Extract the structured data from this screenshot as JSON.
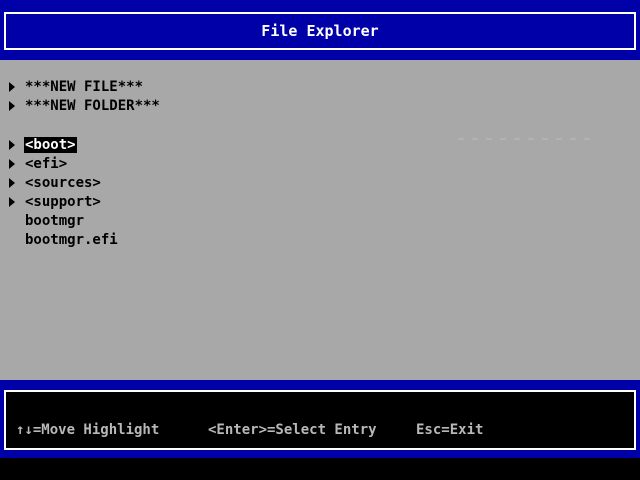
{
  "title": "File Explorer",
  "colors": {
    "title_bg": "#0000a8",
    "body_bg": "#a8a8a8",
    "highlight_bg": "#000000",
    "highlight_fg": "#ffffff",
    "footer_text": "#b8b8b8"
  },
  "actions": [
    {
      "label": "***NEW FILE***",
      "icon": "triangle-right-icon"
    },
    {
      "label": "***NEW FOLDER***",
      "icon": "triangle-right-icon"
    }
  ],
  "entries": [
    {
      "label": "<boot>",
      "type": "folder",
      "selected": true
    },
    {
      "label": "<efi>",
      "type": "folder",
      "selected": false
    },
    {
      "label": "<sources>",
      "type": "folder",
      "selected": false
    },
    {
      "label": "<support>",
      "type": "folder",
      "selected": false
    },
    {
      "label": "bootmgr",
      "type": "file",
      "selected": false
    },
    {
      "label": "bootmgr.efi",
      "type": "file",
      "selected": false
    }
  ],
  "footer": {
    "move": "↑↓=Move Highlight",
    "select": "<Enter>=Select Entry",
    "exit": "Esc=Exit"
  }
}
